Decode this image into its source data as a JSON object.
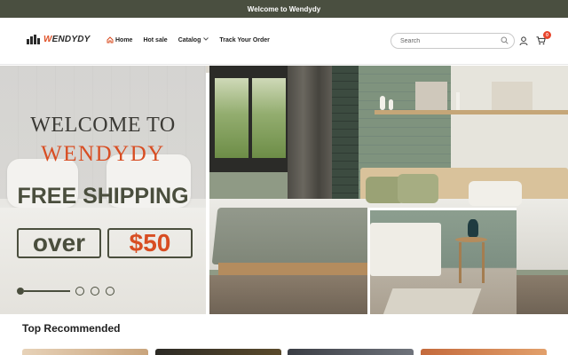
{
  "announcement": {
    "text": "Welcome to Wendydy"
  },
  "header": {
    "logo": {
      "prefix": "W",
      "rest": "ENDYDY"
    },
    "nav": [
      {
        "label": "Home",
        "icon": "home-icon"
      },
      {
        "label": "Hot sale"
      },
      {
        "label": "Catalog",
        "icon": "chevron-down-icon"
      },
      {
        "label": "Track Your Order"
      }
    ],
    "search": {
      "placeholder": "Search",
      "value": ""
    },
    "cart_count": "0"
  },
  "hero": {
    "line1": "WELCOME TO",
    "line2": "WENDYDY",
    "line3": "FREE SHIPPING",
    "box1": "over",
    "box2": "$50",
    "slides_total": 4,
    "active_slide": 1
  },
  "colors": {
    "announcement_bg": "#4a4f40",
    "brand_orange": "#d84d22",
    "brand_olive": "#4a4e3d",
    "cart_badge": "#e8452c"
  },
  "recommended": {
    "title": "Top Recommended"
  }
}
